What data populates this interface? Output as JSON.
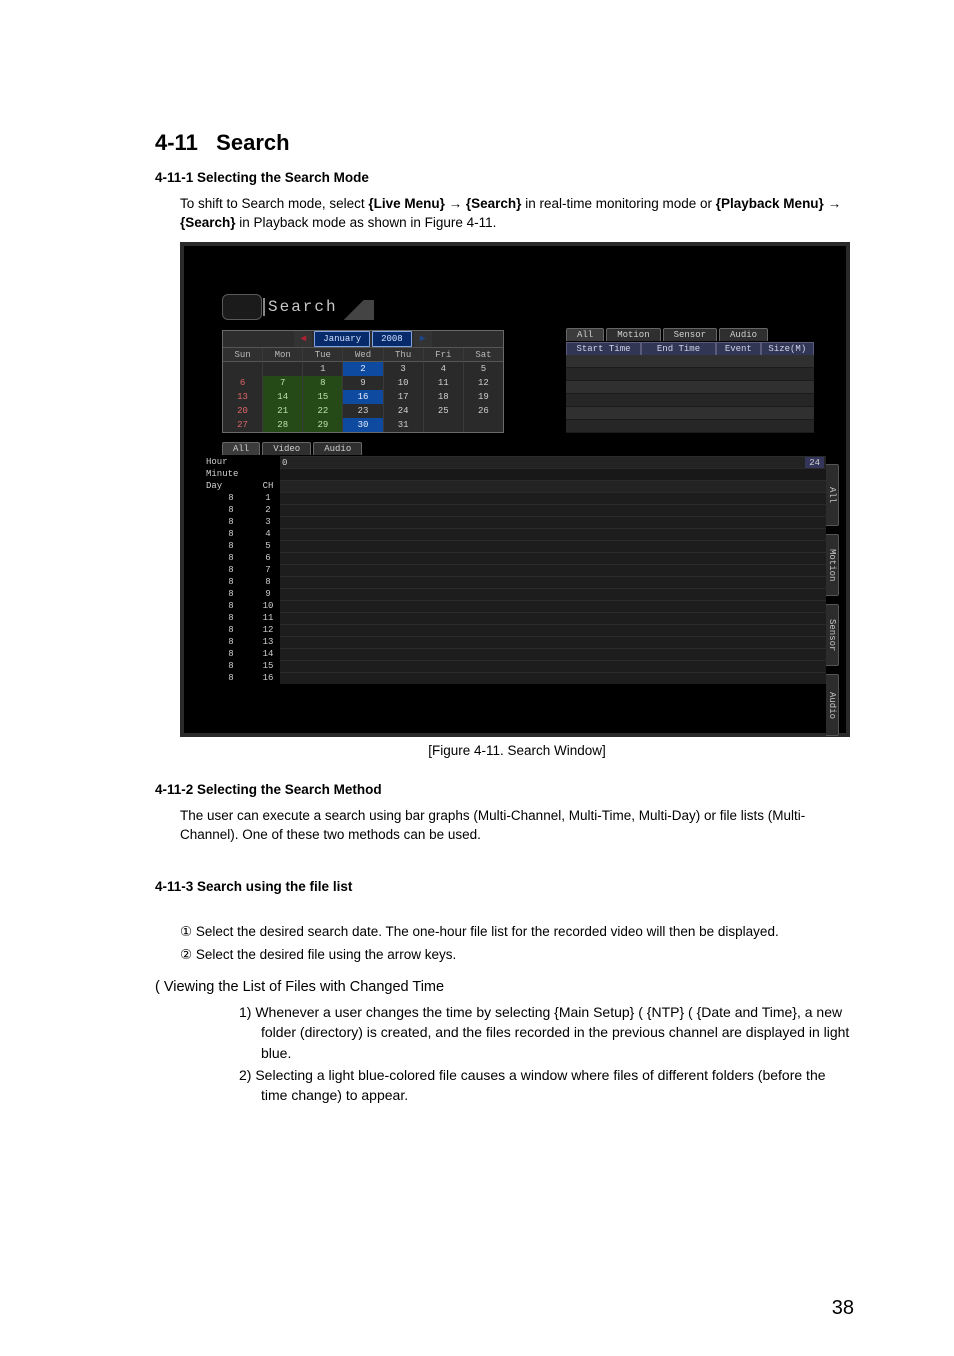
{
  "section": {
    "number": "4-11",
    "title": "Search"
  },
  "sub1": {
    "heading": "4-11-1  Selecting the Search Mode",
    "para_prefix": "To shift to Search mode, select ",
    "live_menu": "{Live Menu}",
    "arrow": " → ",
    "search_tag": "{Search}",
    "mid1": " in real-time monitoring mode or ",
    "playback_menu": "{Playback Menu}",
    "tail": " in Playback mode as shown in Figure 4-11."
  },
  "screenshot": {
    "window_title": "Search",
    "calendar": {
      "month": "January",
      "year": "2008",
      "dow": [
        "Sun",
        "Mon",
        "Tue",
        "Wed",
        "Thu",
        "Fri",
        "Sat"
      ],
      "weeks": [
        [
          "",
          "",
          "1",
          "2",
          "3",
          "4",
          "5"
        ],
        [
          "6",
          "7",
          "8",
          "9",
          "10",
          "11",
          "12"
        ],
        [
          "13",
          "14",
          "15",
          "16",
          "17",
          "18",
          "19"
        ],
        [
          "20",
          "21",
          "22",
          "23",
          "24",
          "25",
          "26"
        ],
        [
          "27",
          "28",
          "29",
          "30",
          "31",
          "",
          ""
        ]
      ],
      "marked_green": [
        "7",
        "8",
        "14",
        "15",
        "21",
        "22",
        "28",
        "29"
      ],
      "selected_blue": [
        "2",
        "16",
        "30"
      ]
    },
    "event_tabs": [
      "All",
      "Motion",
      "Sensor",
      "Audio"
    ],
    "event_tab_selected": "All",
    "event_headers": {
      "start": "Start Time",
      "end": "End Time",
      "event": "Event",
      "size": "Size(M)"
    },
    "lower_tabs": [
      "All",
      "Video",
      "Audio"
    ],
    "lower_tab_selected": "All",
    "timeline_rows": {
      "hour": "Hour",
      "minute": "Minute",
      "day": "Day",
      "ch": "CH",
      "hour_start": "0",
      "hour_end": "24",
      "days": [
        "8",
        "8",
        "8",
        "8",
        "8",
        "8",
        "8",
        "8",
        "8",
        "8",
        "8",
        "8",
        "8",
        "8",
        "8",
        "8"
      ],
      "channels": [
        "1",
        "2",
        "3",
        "4",
        "5",
        "6",
        "7",
        "8",
        "9",
        "10",
        "11",
        "12",
        "13",
        "14",
        "15",
        "16"
      ]
    },
    "vertical_tabs": [
      "All",
      "Motion",
      "Sensor",
      "Audio"
    ]
  },
  "figure_caption": "[Figure 4-11. Search Window]",
  "sub2": {
    "heading": "4-11-2  Selecting the Search Method",
    "para": "The user can execute a search using bar graphs (Multi-Channel, Multi-Time, Multi-Day) or file lists (Multi-Channel). One of these two methods can be used."
  },
  "sub3": {
    "heading": "4-11-3  Search using the file list",
    "step1_bullet": "①",
    "step1": " Select the desired search date. The one-hour file list for the recorded video will then be displayed.",
    "step2_bullet": "②",
    "step2": " Select the desired file using the arrow keys."
  },
  "viewing": {
    "heading": "( Viewing the List of Files with Changed Time",
    "n1": "1)",
    "item1": "  Whenever a user changes the time by selecting {Main Setup} ( {NTP} ( {Date and Time}, a new folder (directory) is created, and the files recorded in the previous channel are displayed in light blue.",
    "n2": "2)",
    "item2": "  Selecting a light blue-colored file causes a window where files of different folders (before the time change) to appear."
  },
  "page_number": "38"
}
